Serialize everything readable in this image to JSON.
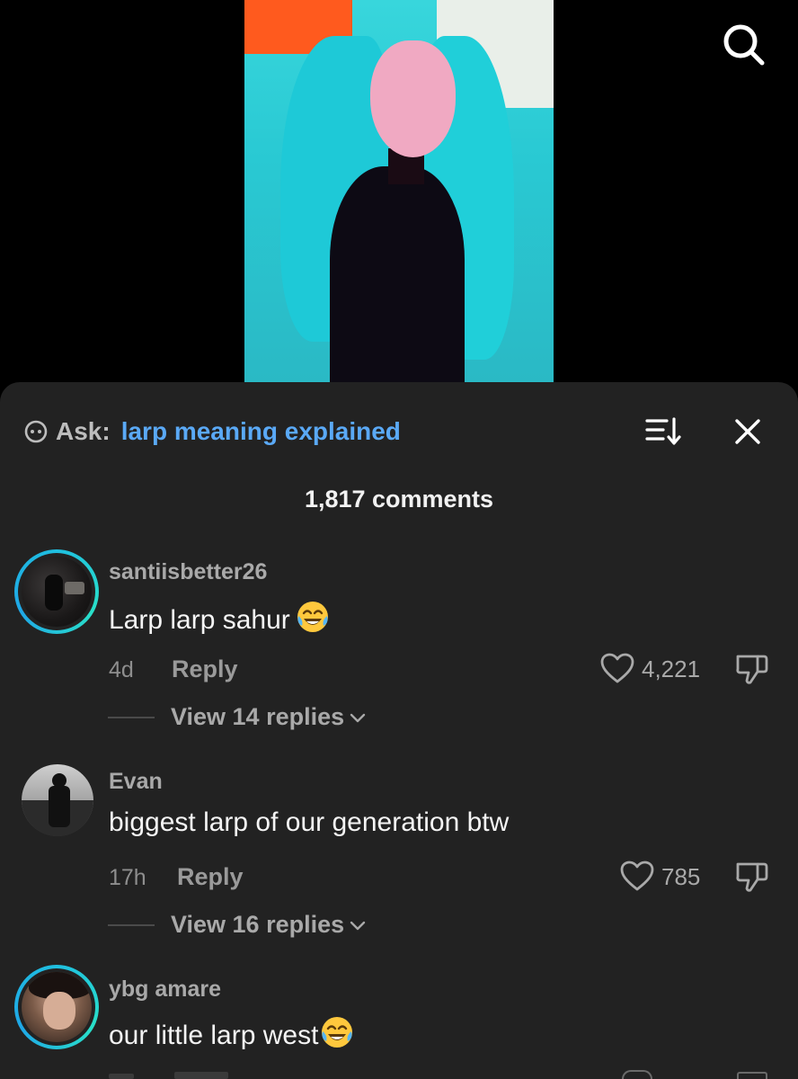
{
  "ask": {
    "label": "Ask:",
    "query": "larp meaning explained"
  },
  "header": {
    "comment_count": "1,817 comments"
  },
  "comments": [
    {
      "username": "santiisbetter26",
      "text": "Larp larp sahur",
      "emoji": "face-with-tears-of-joy",
      "time": "4d",
      "reply_label": "Reply",
      "likes": "4,221",
      "view_replies": "View 14 replies",
      "story_ring": true
    },
    {
      "username": "Evan",
      "text": "biggest larp of our generation btw",
      "time": "17h",
      "reply_label": "Reply",
      "likes": "785",
      "view_replies": "View 16 replies",
      "story_ring": false
    },
    {
      "username": "ybg amare",
      "text": "our little larp west",
      "emoji": "face-with-tears-of-joy",
      "story_ring": true
    }
  ],
  "colors": {
    "sheet_bg": "#222222",
    "ask_query": "#5aa9f6",
    "story_ring": "#1fbfe0",
    "text_primary": "#f4f4f4",
    "text_secondary": "#a9a9a9"
  },
  "icons": {
    "top_right": "search-icon",
    "sort": "sort-icon",
    "close": "close-icon",
    "like": "heart-icon",
    "dislike": "dislike-icon",
    "expand": "chevron-down-icon",
    "ask": "ai-assistant-icon"
  }
}
